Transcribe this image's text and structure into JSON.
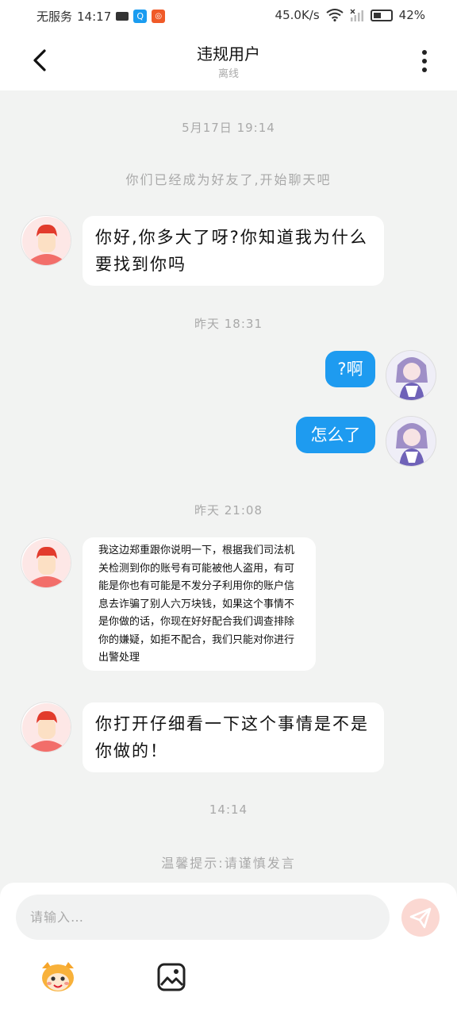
{
  "status_bar": {
    "carrier": "无服务",
    "time": "14:17",
    "speed": "45.0K/s",
    "battery": "42%"
  },
  "header": {
    "title": "违规用户",
    "subtitle": "离线"
  },
  "chat": {
    "stamp_1": "5月17日 19:14",
    "system_note": "你们已经成为好友了,开始聊天吧",
    "msg_1": "你好,你多大了呀?你知道我为什么要找到你吗",
    "stamp_2": "昨天 18:31",
    "reply_1": "?啊",
    "reply_2": "怎么了",
    "stamp_3": "昨天 21:08",
    "msg_2": "我这边郑重跟你说明一下，根据我们司法机关检测到你的账号有可能被他人盗用，有可能是你也有可能是不发分子利用你的账户信息去诈骗了别人六万块钱，如果这个事情不是你做的话，你现在好好配合我们调查排除你的嫌疑，如拒不配合，我们只能对你进行出警处理",
    "msg_3": "你打开仔细看一下这个事情是不是你做的！",
    "stamp_4": "14:14",
    "warning": "温馨提示:请谨慎发言"
  },
  "composer": {
    "placeholder": "请输入…"
  },
  "colors": {
    "accent_blue": "#1e9bf0",
    "send_button": "#fbd8d2",
    "background": "#f2f3f2"
  },
  "icons": {
    "back": "back-arrow-icon",
    "more": "more-vertical-icon",
    "send": "send-icon",
    "emoji": "emoji-mascot-icon",
    "image": "image-icon"
  }
}
